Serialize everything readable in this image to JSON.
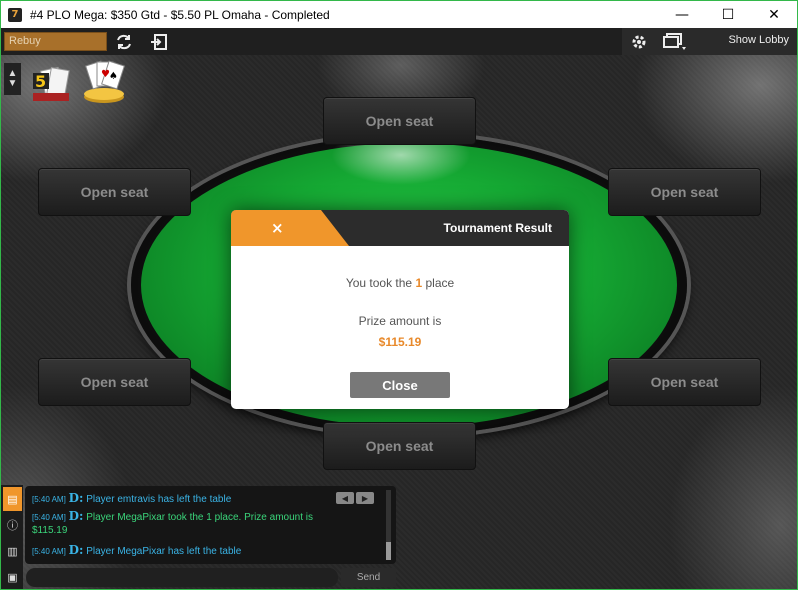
{
  "window": {
    "title": "#4 PLO Mega: $350 Gtd - $5.50 PL Omaha - Completed",
    "app_icon_letter": "7",
    "minimize": "—",
    "maximize": "☐",
    "close": "✕"
  },
  "toolbar": {
    "rebuy_label": "Rebuy",
    "show_lobby_label": "Show Lobby",
    "icons": [
      "refresh-icon",
      "exit-icon",
      "gear-icon",
      "table-view-icon"
    ]
  },
  "seats": [
    {
      "label": "Open seat"
    },
    {
      "label": "Open seat"
    },
    {
      "label": "Open seat"
    },
    {
      "label": "Open seat"
    },
    {
      "label": "Open seat"
    },
    {
      "label": "Open seat"
    }
  ],
  "modal": {
    "close_glyph": "×",
    "title": "Tournament Result",
    "place_prefix": "You took the",
    "place_value": "1",
    "place_suffix": "place",
    "prize_label": "Prize amount is",
    "prize_value": "$115.19",
    "close_button": "Close"
  },
  "chat": {
    "messages": [
      {
        "time": "[5:40 AM]",
        "badge": "D:",
        "text": "Player emtravis  has left the table"
      },
      {
        "time": "[5:40 AM]",
        "badge": "D:",
        "text": "Player MegaPixar  took the 1 place. Prize amount is",
        "continuation": "$115.19"
      },
      {
        "time": "[5:40 AM]",
        "badge": "D:",
        "text": "Player MegaPixar  has left the table"
      }
    ],
    "nav_prev": "◀",
    "nav_next": "▶",
    "input_value": "",
    "send_label": "Send"
  },
  "colors": {
    "accent": "#f0962b",
    "felt": "#15a833",
    "chat_text": "#3ab4e6",
    "chat_win_text": "#3ad47a",
    "window_border": "#33b84a"
  }
}
